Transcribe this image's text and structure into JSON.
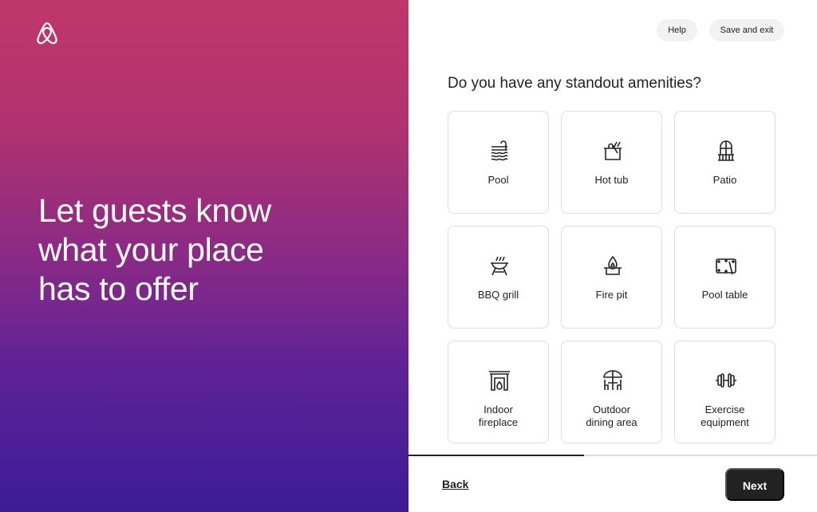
{
  "brand": {
    "logo_icon": "airbnb-logo",
    "gradient": [
      "#c0376a",
      "#8a2a86",
      "#3c1c98"
    ]
  },
  "hero": {
    "line1": "Let guests know",
    "line2": "what your place",
    "line3": "has to offer"
  },
  "header": {
    "help": "Help",
    "save_exit": "Save and exit"
  },
  "title": "Do you have any standout amenities?",
  "amenities": [
    {
      "label": "Pool",
      "icon": "pool-icon"
    },
    {
      "label": "Hot tub",
      "icon": "hot-tub-icon"
    },
    {
      "label": "Patio",
      "icon": "patio-icon"
    },
    {
      "label": "BBQ grill",
      "icon": "bbq-grill-icon"
    },
    {
      "label": "Fire pit",
      "icon": "fire-pit-icon"
    },
    {
      "label": "Pool table",
      "icon": "pool-table-icon"
    },
    {
      "label": "Indoor fireplace",
      "icon": "fireplace-icon"
    },
    {
      "label": "Outdoor dining area",
      "icon": "outdoor-dining-icon"
    },
    {
      "label": "Exercise equipment",
      "icon": "exercise-equipment-icon"
    }
  ],
  "progress_percent": 43,
  "footer": {
    "back": "Back",
    "next": "Next"
  }
}
